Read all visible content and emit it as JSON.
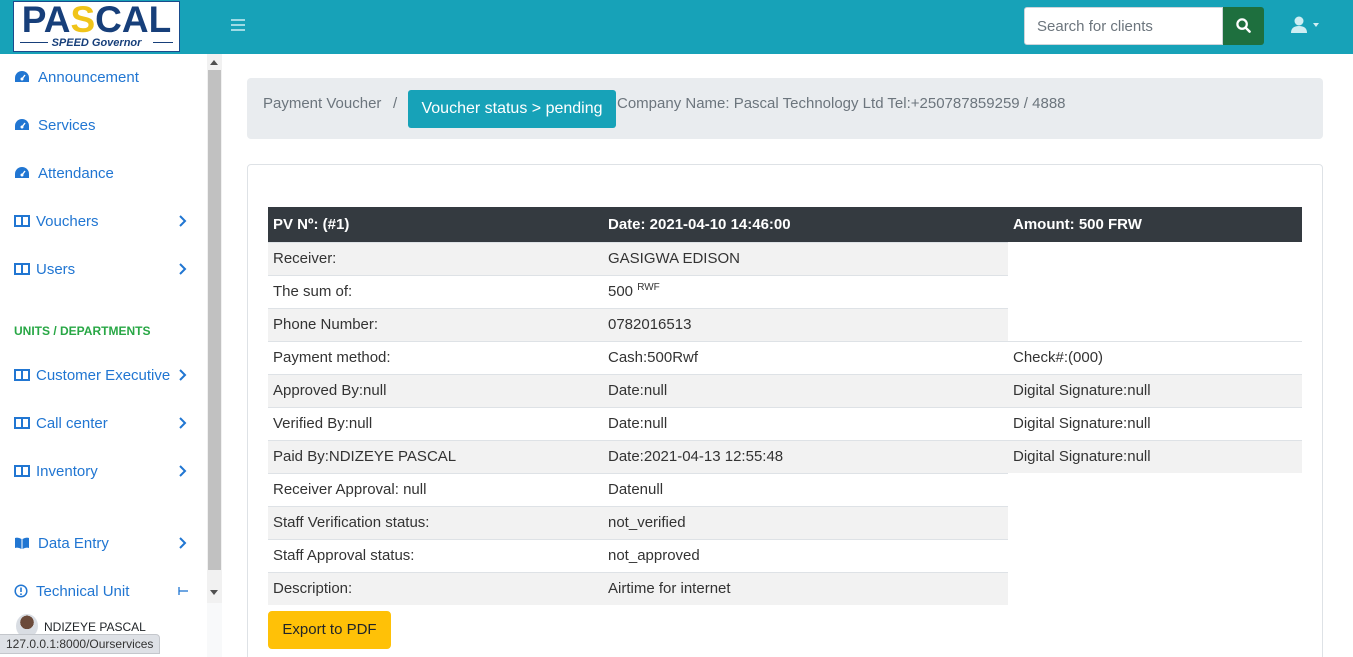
{
  "brand": {
    "logo_text_1": "PA",
    "logo_text_accent": "S",
    "logo_text_2": "CAL",
    "logo_sub": "SPEED Governor"
  },
  "topbar": {
    "menu_icon": "hamburger-icon",
    "search": {
      "placeholder": "Search for clients",
      "value": "",
      "button_icon": "search-icon"
    },
    "user_icon": "user-icon",
    "colors": {
      "bar": "#17a2b8",
      "search_button": "#1e6f3e"
    }
  },
  "sidebar": {
    "items": [
      {
        "label": "Announcement",
        "icon": "dashboard-gauge-icon"
      },
      {
        "label": "Services",
        "icon": "dashboard-gauge-icon"
      },
      {
        "label": "Attendance",
        "icon": "dashboard-gauge-icon"
      },
      {
        "label": "Vouchers",
        "icon": "columns-icon",
        "has_submenu": true
      },
      {
        "label": "Users",
        "icon": "columns-icon",
        "has_submenu": true
      }
    ],
    "section_title": "UNITS / DEPARTMENTS",
    "dept_items": [
      {
        "label": "Customer Executive",
        "icon": "columns-icon",
        "has_submenu": true
      },
      {
        "label": "Call center",
        "icon": "columns-icon",
        "has_submenu": true
      },
      {
        "label": "Inventory",
        "icon": "columns-icon",
        "has_submenu": true
      },
      {
        "label": "Data Entry",
        "icon": "book-open-icon",
        "has_submenu": true
      },
      {
        "label": "Technical Unit",
        "icon": "info-circle-icon",
        "has_submenu": true
      }
    ],
    "user_name": "NDIZEYE PASCAL"
  },
  "status_bar_url": "127.0.0.1:8000/Ourservices",
  "breadcrumb": {
    "link": "Payment Voucher",
    "separator": "/",
    "badge": "Voucher status > pending",
    "company": "Company Name: Pascal Technology Ltd Tel:+250787859259 / 4888"
  },
  "voucher": {
    "header": {
      "pv": "PV Nº: (#1)",
      "date": "Date: 2021-04-10 14:46:00",
      "amount": "Amount: 500 FRW"
    },
    "receiver_label": "Receiver:",
    "receiver_value": "GASIGWA EDISON",
    "sum_label": "The sum of:",
    "sum_value": "500",
    "sum_unit": "RWF",
    "phone_label": "Phone Number:",
    "phone_value": "0782016513",
    "payment_label": "Payment method:",
    "payment_value": "Cash:500Rwf",
    "check_value": "Check#:(000)",
    "approved_label": "Approved By:null",
    "approved_date": "Date:null",
    "approved_sig": "Digital Signature:null",
    "verified_label": "Verified By:null",
    "verified_date": "Date:null",
    "verified_sig": "Digital Signature:null",
    "paid_label": "Paid By:NDIZEYE PASCAL",
    "paid_date": "Date:2021-04-13 12:55:48",
    "paid_sig": "Digital Signature:null",
    "receiver_approval_label": "Receiver Approval: null",
    "receiver_approval_value": "Datenull",
    "staff_verification_label": "Staff Verification status:",
    "staff_verification_value": "not_verified",
    "staff_approval_label": "Staff Approval status:",
    "staff_approval_value": "not_approved",
    "description_label": "Description:",
    "description_value": "Airtime for internet"
  },
  "export_button": "Export to PDF"
}
